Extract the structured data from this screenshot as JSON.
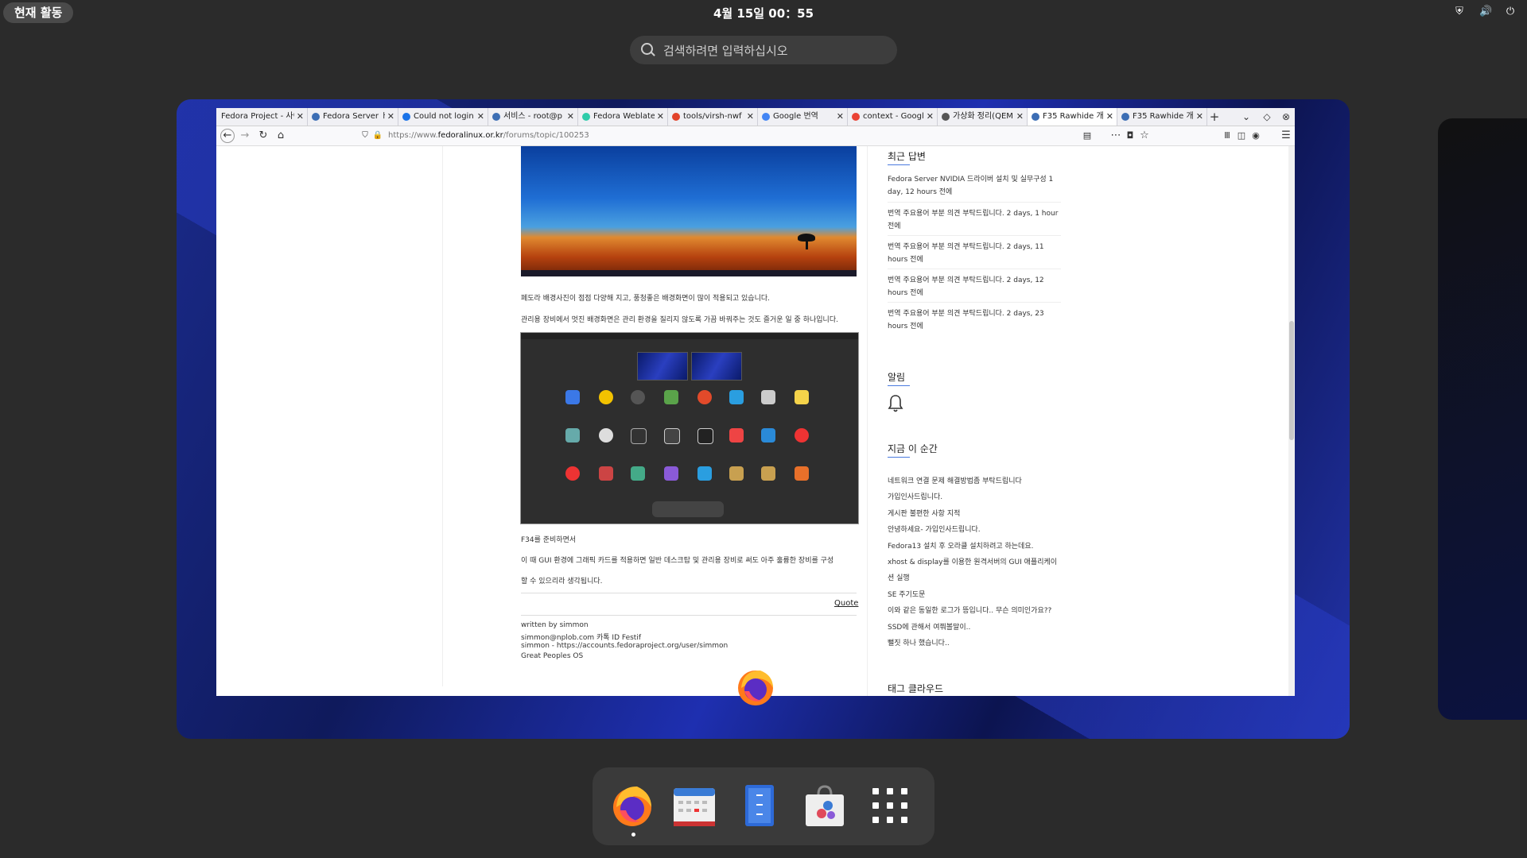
{
  "topbar": {
    "activities": "현재 활동",
    "clock": "4월 15일  00：55",
    "tray_icons": [
      "shield-icon",
      "volume-icon",
      "power-icon"
    ]
  },
  "search": {
    "placeholder": "검색하려면 입력하십시오"
  },
  "browser": {
    "tabs": [
      {
        "label": "Fedora Project - 사이",
        "icon_color": "#3c6eb4"
      },
      {
        "label": "Fedora Server ド",
        "icon_color": "#3c6eb4"
      },
      {
        "label": "Could not login",
        "icon_color": "#1a73e8"
      },
      {
        "label": "서비스 - root@p",
        "icon_color": "#3c6eb4"
      },
      {
        "label": "Fedora Weblate",
        "icon_color": "#2eccaa"
      },
      {
        "label": "tools/virsh-nwf",
        "icon_color": "#e2432a"
      },
      {
        "label": "Google 번역",
        "icon_color": "#4285f4"
      },
      {
        "label": "context - Googl",
        "icon_color": "#ea4335"
      },
      {
        "label": "가상화 정리(QEM",
        "icon_color": "#555555"
      },
      {
        "label": "F35 Rawhide 개",
        "icon_color": "#3c6eb4",
        "active": true
      },
      {
        "label": "F35 Rawhide 개",
        "icon_color": "#3c6eb4"
      }
    ],
    "new_tab": "+",
    "url_prefix": "https://www.",
    "url_domain": "fedoralinux.or.kr",
    "url_path": "/forums/topic/100253"
  },
  "post": {
    "para1": "페도라 배경사진이 점점 다양해 지고, 풍청좋은 배경화면이 많이 적용되고 있습니다.",
    "para2": "관리용 장비에서 멋진 배경화면은 관리 환경을 질리지 않도록 가끔 바꿔주는 것도 즐거운 일 중 하나입니다.",
    "para3": "F34를 준비하면서",
    "para4": "이 때 GUI 환경에 그래픽 카드를 적용하면 일반 데스크탑 및 관리용 장비로 써도 아주 훌륭한 장비를 구성",
    "para5": "할 수 있으리라 생각됩니다.",
    "quote": "Quote",
    "sig1": "written by simmon",
    "sig2": "simmon@nplob.com 카톡 ID Festif",
    "sig3": "simmon - https://accounts.fedoraproject.org/user/simmon",
    "sig4": "Great Peoples OS"
  },
  "sidebar": {
    "recent_title": "최근 답변",
    "recent": [
      "Fedora Server NVIDIA 드라이버 설치 및 실무구성 1 day, 12 hours 전에",
      "번역 주요용어 부분 의견 부탁드립니다. 2 days, 1 hour 전에",
      "번역 주요용어 부분 의견 부탁드립니다. 2 days, 11 hours 전에",
      "번역 주요용어 부분 의견 부탁드립니다. 2 days, 12 hours 전에",
      "번역 주요용어 부분 의견 부탁드립니다. 2 days, 23 hours 전에"
    ],
    "notice_title": "알림",
    "now_title": "지금 이 순간",
    "now": [
      "네트워크 연결 문제 해결방법좀 부탁드립니다",
      "가입인사드립니다.",
      "게시판 불편한 사항 지적",
      "안녕하세요- 가입인사드립니다.",
      "Fedora13 설치 후 오라클 설치하려고 하는데요.",
      "xhost & display를 이용한 원격서버의 GUI 애플리케이",
      "션 실행",
      "SE 주기도문",
      "이와 같은 동일한 로그가 뜽입니다.. 무슨 의미인가요??",
      "SSD에 관해서 여쭤볼말이..",
      "뻘짓 하나 했습니다.."
    ],
    "tags_title": "태그 클라우드"
  },
  "dash": {
    "apps": [
      "firefox-icon",
      "calendar-icon",
      "files-icon",
      "software-icon",
      "app-grid-icon"
    ]
  }
}
